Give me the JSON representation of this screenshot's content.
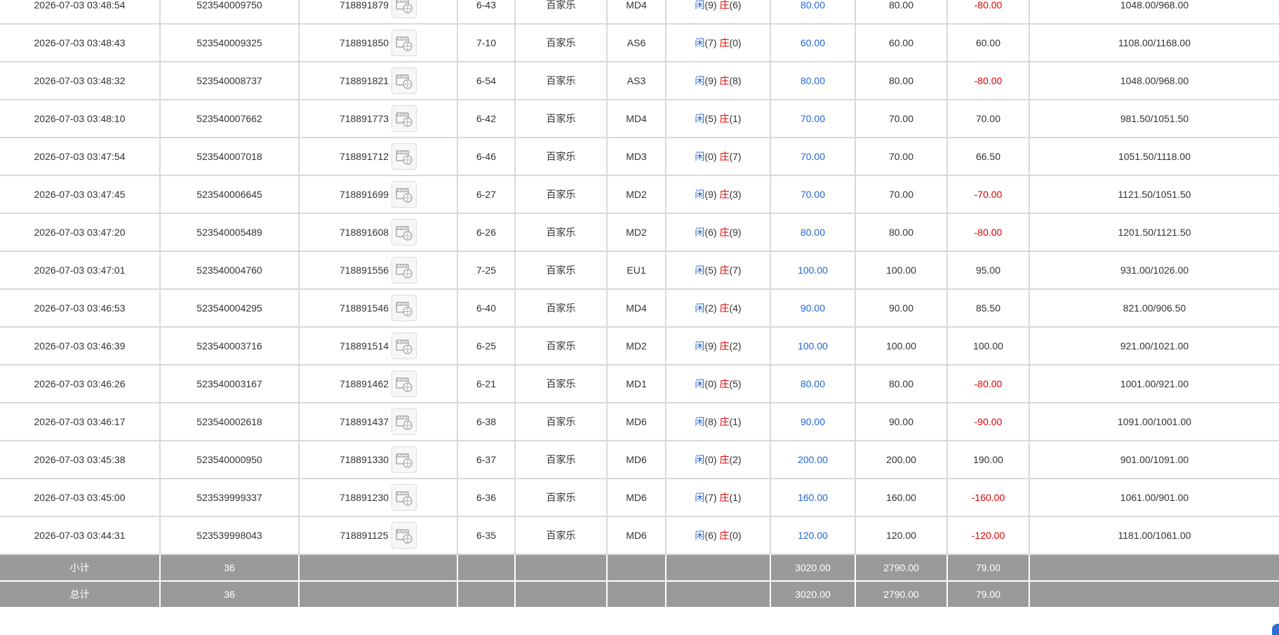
{
  "rows": [
    {
      "time": "2026-07-03 03:48:54",
      "bet_id": "523540009750",
      "round": "718891879",
      "shoe": "6-43",
      "game": "百家乐",
      "table": "MD4",
      "p_label": "闲",
      "p_val": "(9)",
      "b_label": "庄",
      "b_val": "(6)",
      "bet": "80.00",
      "valid": "80.00",
      "win": "-80.00",
      "win_negative": true,
      "balance": "1048.00/968.00"
    },
    {
      "time": "2026-07-03 03:48:43",
      "bet_id": "523540009325",
      "round": "718891850",
      "shoe": "7-10",
      "game": "百家乐",
      "table": "AS6",
      "p_label": "闲",
      "p_val": "(7)",
      "b_label": "庄",
      "b_val": "(0)",
      "bet": "60.00",
      "valid": "60.00",
      "win": "60.00",
      "win_negative": false,
      "balance": "1108.00/1168.00"
    },
    {
      "time": "2026-07-03 03:48:32",
      "bet_id": "523540008737",
      "round": "718891821",
      "shoe": "6-54",
      "game": "百家乐",
      "table": "AS3",
      "p_label": "闲",
      "p_val": "(9)",
      "b_label": "庄",
      "b_val": "(8)",
      "bet": "80.00",
      "valid": "80.00",
      "win": "-80.00",
      "win_negative": true,
      "balance": "1048.00/968.00"
    },
    {
      "time": "2026-07-03 03:48:10",
      "bet_id": "523540007662",
      "round": "718891773",
      "shoe": "6-42",
      "game": "百家乐",
      "table": "MD4",
      "p_label": "闲",
      "p_val": "(5)",
      "b_label": "庄",
      "b_val": "(1)",
      "bet": "70.00",
      "valid": "70.00",
      "win": "70.00",
      "win_negative": false,
      "balance": "981.50/1051.50"
    },
    {
      "time": "2026-07-03 03:47:54",
      "bet_id": "523540007018",
      "round": "718891712",
      "shoe": "6-46",
      "game": "百家乐",
      "table": "MD3",
      "p_label": "闲",
      "p_val": "(0)",
      "b_label": "庄",
      "b_val": "(7)",
      "bet": "70.00",
      "valid": "70.00",
      "win": "66.50",
      "win_negative": false,
      "balance": "1051.50/1118.00"
    },
    {
      "time": "2026-07-03 03:47:45",
      "bet_id": "523540006645",
      "round": "718891699",
      "shoe": "6-27",
      "game": "百家乐",
      "table": "MD2",
      "p_label": "闲",
      "p_val": "(9)",
      "b_label": "庄",
      "b_val": "(3)",
      "bet": "70.00",
      "valid": "70.00",
      "win": "-70.00",
      "win_negative": true,
      "balance": "1121.50/1051.50"
    },
    {
      "time": "2026-07-03 03:47:20",
      "bet_id": "523540005489",
      "round": "718891608",
      "shoe": "6-26",
      "game": "百家乐",
      "table": "MD2",
      "p_label": "闲",
      "p_val": "(6)",
      "b_label": "庄",
      "b_val": "(9)",
      "bet": "80.00",
      "valid": "80.00",
      "win": "-80.00",
      "win_negative": true,
      "balance": "1201.50/1121.50"
    },
    {
      "time": "2026-07-03 03:47:01",
      "bet_id": "523540004760",
      "round": "718891556",
      "shoe": "7-25",
      "game": "百家乐",
      "table": "EU1",
      "p_label": "闲",
      "p_val": "(5)",
      "b_label": "庄",
      "b_val": "(7)",
      "bet": "100.00",
      "valid": "100.00",
      "win": "95.00",
      "win_negative": false,
      "balance": "931.00/1026.00"
    },
    {
      "time": "2026-07-03 03:46:53",
      "bet_id": "523540004295",
      "round": "718891546",
      "shoe": "6-40",
      "game": "百家乐",
      "table": "MD4",
      "p_label": "闲",
      "p_val": "(2)",
      "b_label": "庄",
      "b_val": "(4)",
      "bet": "90.00",
      "valid": "90.00",
      "win": "85.50",
      "win_negative": false,
      "balance": "821.00/906.50"
    },
    {
      "time": "2026-07-03 03:46:39",
      "bet_id": "523540003716",
      "round": "718891514",
      "shoe": "6-25",
      "game": "百家乐",
      "table": "MD2",
      "p_label": "闲",
      "p_val": "(9)",
      "b_label": "庄",
      "b_val": "(2)",
      "bet": "100.00",
      "valid": "100.00",
      "win": "100.00",
      "win_negative": false,
      "balance": "921.00/1021.00"
    },
    {
      "time": "2026-07-03 03:46:26",
      "bet_id": "523540003167",
      "round": "718891462",
      "shoe": "6-21",
      "game": "百家乐",
      "table": "MD1",
      "p_label": "闲",
      "p_val": "(0)",
      "b_label": "庄",
      "b_val": "(5)",
      "bet": "80.00",
      "valid": "80.00",
      "win": "-80.00",
      "win_negative": true,
      "balance": "1001.00/921.00"
    },
    {
      "time": "2026-07-03 03:46:17",
      "bet_id": "523540002618",
      "round": "718891437",
      "shoe": "6-38",
      "game": "百家乐",
      "table": "MD6",
      "p_label": "闲",
      "p_val": "(8)",
      "b_label": "庄",
      "b_val": "(1)",
      "bet": "90.00",
      "valid": "90.00",
      "win": "-90.00",
      "win_negative": true,
      "balance": "1091.00/1001.00"
    },
    {
      "time": "2026-07-03 03:45:38",
      "bet_id": "523540000950",
      "round": "718891330",
      "shoe": "6-37",
      "game": "百家乐",
      "table": "MD6",
      "p_label": "闲",
      "p_val": "(0)",
      "b_label": "庄",
      "b_val": "(2)",
      "bet": "200.00",
      "valid": "200.00",
      "win": "190.00",
      "win_negative": false,
      "balance": "901.00/1091.00"
    },
    {
      "time": "2026-07-03 03:45:00",
      "bet_id": "523539999337",
      "round": "718891230",
      "shoe": "6-36",
      "game": "百家乐",
      "table": "MD6",
      "p_label": "闲",
      "p_val": "(7)",
      "b_label": "庄",
      "b_val": "(1)",
      "bet": "160.00",
      "valid": "160.00",
      "win": "-160.00",
      "win_negative": true,
      "balance": "1061.00/901.00"
    },
    {
      "time": "2026-07-03 03:44:31",
      "bet_id": "523539998043",
      "round": "718891125",
      "shoe": "6-35",
      "game": "百家乐",
      "table": "MD6",
      "p_label": "闲",
      "p_val": "(6)",
      "b_label": "庄",
      "b_val": "(0)",
      "bet": "120.00",
      "valid": "120.00",
      "win": "-120.00",
      "win_negative": true,
      "balance": "1181.00/1061.00"
    }
  ],
  "summary": [
    {
      "label": "小计",
      "count": "36",
      "bet": "3020.00",
      "valid": "2790.00",
      "win": "79.00"
    },
    {
      "label": "总计",
      "count": "36",
      "bet": "3020.00",
      "valid": "2790.00",
      "win": "79.00"
    }
  ],
  "colors": {
    "blue": "#2066d6",
    "red": "#e00000",
    "summary_bg": "#9a9a9a"
  },
  "icons": {
    "round_video": "video-replay-icon"
  }
}
